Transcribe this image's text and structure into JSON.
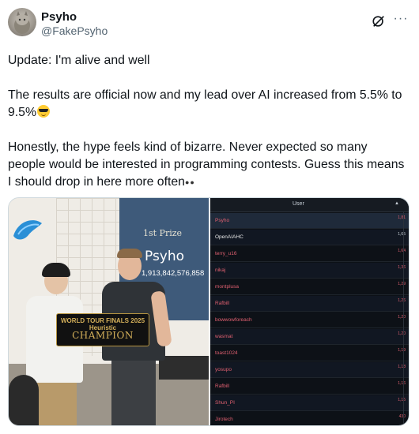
{
  "author": {
    "name": "Psyho",
    "handle": "@FakePsyho",
    "avatar_icon": "avatar-photo"
  },
  "header_icons": {
    "grok_icon": "grok-icon",
    "more_label": "···"
  },
  "tweet": {
    "line1": "Update: I'm alive and well",
    "para2": "The results are official now and my lead over AI increased from 5.5% to 9.5%",
    "para3": "Honestly, the hype feels kind of bizarre. Never expected so many people would be interested in programming contests. Guess this means I should drop in here more often",
    "emoji1": "sunglasses-emoji",
    "emoji2": "eyes-emoji"
  },
  "photo": {
    "screen_label": "1st Prize",
    "screen_name": "Psyho",
    "screen_score": "1,913,842,576,858",
    "banner_top": "WORLD TOUR FINALS 2025 Heuristic",
    "banner_text": "CHAMPION"
  },
  "leaderboard": {
    "column_header": "User",
    "sort_icon": "▲",
    "rows": [
      {
        "user": "Psyho",
        "score": "1,81",
        "color": "red",
        "highlight": true
      },
      {
        "user": "OpenAIAHC",
        "score": "1,65",
        "color": "white",
        "highlight": false
      },
      {
        "user": "terry_u16",
        "score": "1,64",
        "color": "red",
        "highlight": false
      },
      {
        "user": "nikaj",
        "score": "1,36",
        "color": "red",
        "highlight": false
      },
      {
        "user": "montplusa",
        "score": "1,29",
        "color": "red",
        "highlight": false
      },
      {
        "user": "Rafbill",
        "score": "1,26",
        "color": "red",
        "highlight": false
      },
      {
        "user": "bowwowforeach",
        "score": "1,20",
        "color": "red",
        "highlight": false
      },
      {
        "user": "wasmat",
        "score": "1,20",
        "color": "red",
        "highlight": false
      },
      {
        "user": "toast1024",
        "score": "1,19",
        "color": "red",
        "highlight": false
      },
      {
        "user": "yosupo",
        "score": "1,18",
        "color": "red",
        "highlight": false
      },
      {
        "user": "Rafbill",
        "score": "1,16",
        "color": "red",
        "highlight": false
      },
      {
        "user": "Shun_PI",
        "score": "1,15",
        "color": "red",
        "highlight": false
      },
      {
        "user": "Jirotech",
        "score": "430",
        "color": "red",
        "highlight": false
      }
    ]
  }
}
